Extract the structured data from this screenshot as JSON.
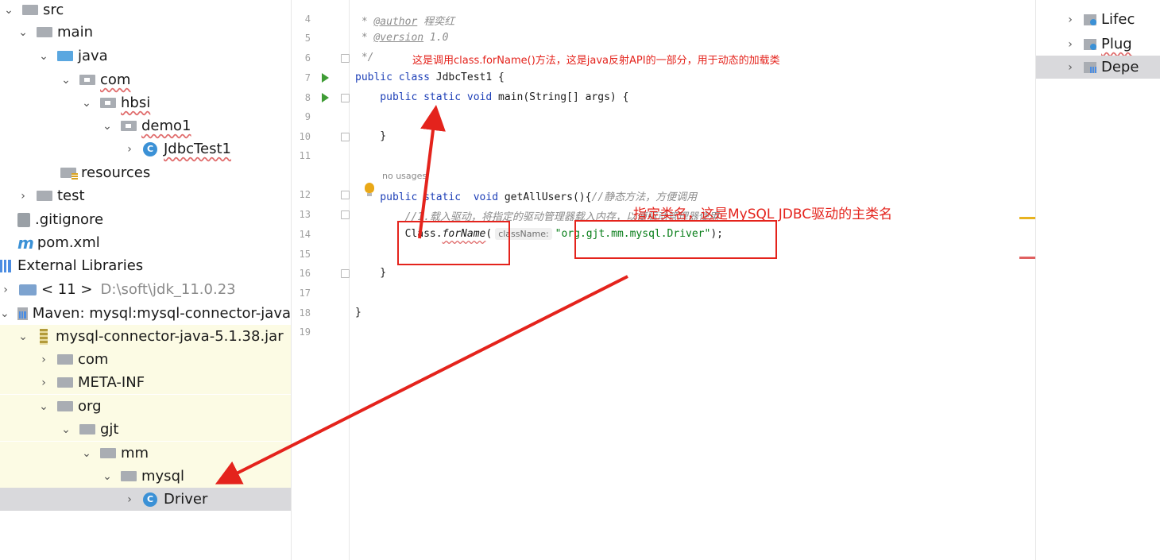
{
  "tree": {
    "src": "src",
    "main": "main",
    "java": "java",
    "com": "com",
    "hbsi": "hbsi",
    "demo1": "demo1",
    "jdbctest1": "JdbcTest1",
    "resources": "resources",
    "test": "test",
    "gitignore": ".gitignore",
    "pom": "pom.xml",
    "external_libraries": "External Libraries",
    "jdk_label": "< 11 >",
    "jdk_path": "D:\\soft\\jdk_11.0.23",
    "maven_lib": "Maven: mysql:mysql-connector-java",
    "jar": "mysql-connector-java-5.1.38.jar",
    "jar_com": "com",
    "meta_inf": "META-INF",
    "org": "org",
    "gjt": "gjt",
    "mm": "mm",
    "mysql": "mysql",
    "driver": "Driver"
  },
  "editor": {
    "line_numbers": [
      "4",
      "5",
      "6",
      "7",
      "8",
      "9",
      "10",
      "11",
      "12",
      "13",
      "14",
      "15",
      "16",
      "17",
      "18",
      "19"
    ],
    "l4_star": " * ",
    "l4_tag": "@author",
    "l4_val": " 程奕红",
    "l5_star": " * ",
    "l5_tag": "@version",
    "l5_val": " 1.0",
    "l6": " */",
    "l7_kw": "public class",
    "l7_rest": " JdbcTest1 {",
    "l8_kw1": "    public ",
    "l8_kw2": "static",
    "l8_kw3": " void",
    "l8_rest": " main(String[] args) {",
    "l10": "    }",
    "no_usages": "no usages",
    "l12_kw1": "    public ",
    "l12_kw2": "static",
    "l12_kw3": "  void",
    "l12_rest": " getAllUsers(){",
    "l12_comment": "//静态方法，方便调用",
    "l13_comment": "        //1.载入驱动，将指定的驱动管理器载入内存，以便驱动管理器使用",
    "l14_pre": "        Class.",
    "l14_method": "forName",
    "l14_paren": "(",
    "l14_hint": "className:",
    "l14_str": "\"org.gjt.mm.mysql.Driver\"",
    "l14_end": ");",
    "l16": "    }",
    "l18": "}"
  },
  "annotations": {
    "top": "这是调用class.forName()方法，这是java反射API的一部分，用于动态的加载类",
    "middle": "指定类名，这是MySQL JDBC驱动的主类名"
  },
  "right_panel": {
    "lifecycle": "Lifec",
    "plugins": "Plug",
    "dependencies": "Depe"
  }
}
